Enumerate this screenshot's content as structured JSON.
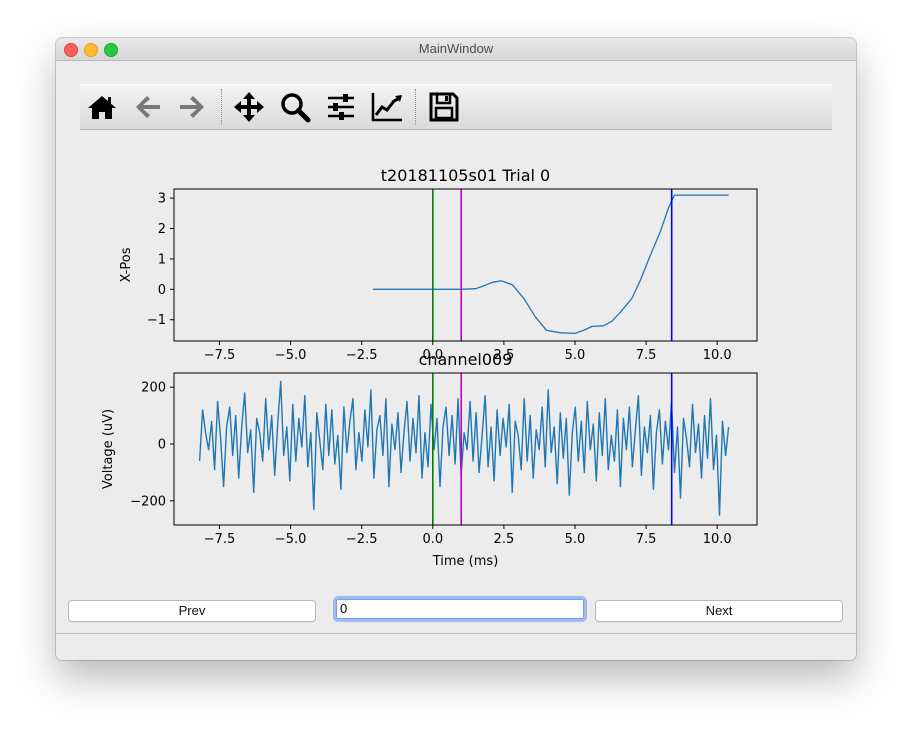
{
  "window": {
    "title": "MainWindow"
  },
  "toolbar": {
    "icons": [
      "home-icon",
      "back-icon",
      "forward-icon",
      "pan-icon",
      "zoom-icon",
      "subplots-icon",
      "customize-icon",
      "save-icon"
    ]
  },
  "controls": {
    "prev_label": "Prev",
    "next_label": "Next",
    "trial_value": "0"
  },
  "colors": {
    "trace": "#1f77b4",
    "green_marker": "#008000",
    "magenta_marker": "#bf00bf",
    "blue_marker": "#0000ff"
  },
  "chart_data": [
    {
      "type": "line",
      "title": "t20181105s01 Trial 0",
      "xlabel": "",
      "ylabel": "X-Pos",
      "xlim": [
        -9.1,
        11.4
      ],
      "ylim": [
        -1.7,
        3.3
      ],
      "xticks": [
        -7.5,
        -5.0,
        -2.5,
        0.0,
        2.5,
        5.0,
        7.5,
        10.0
      ],
      "xticklabels": [
        "−7.5",
        "−5.0",
        "−2.5",
        "0.0",
        "2.5",
        "5.0",
        "7.5",
        "10.0"
      ],
      "yticks": [
        -1,
        0,
        1,
        2,
        3
      ],
      "yticklabels": [
        "−1",
        "0",
        "1",
        "2",
        "3"
      ],
      "vlines": [
        {
          "x": 0.0,
          "color": "#008000"
        },
        {
          "x": 1.0,
          "color": "#bf00bf"
        },
        {
          "x": 8.4,
          "color": "#0000ff"
        }
      ],
      "series": [
        {
          "x": [
            -2.1,
            -1.0,
            0.0,
            1.0,
            1.5,
            1.8,
            2.1,
            2.4,
            2.8,
            3.2,
            3.6,
            4.0,
            4.5,
            5.0,
            5.3,
            5.6,
            6.0,
            6.3,
            6.6,
            7.0,
            7.3,
            7.6,
            8.0,
            8.3,
            8.5,
            9.0,
            9.5,
            10.0,
            10.4
          ],
          "y": [
            0.0,
            0.0,
            0.0,
            0.0,
            0.02,
            0.12,
            0.23,
            0.28,
            0.15,
            -0.3,
            -0.9,
            -1.35,
            -1.43,
            -1.45,
            -1.35,
            -1.22,
            -1.2,
            -1.05,
            -0.75,
            -0.3,
            0.3,
            1.0,
            1.9,
            2.7,
            3.1,
            3.1,
            3.1,
            3.1,
            3.1
          ]
        }
      ]
    },
    {
      "type": "line",
      "title": "channel009",
      "xlabel": "Time (ms)",
      "ylabel": "Voltage (uV)",
      "xlim": [
        -9.1,
        11.4
      ],
      "ylim": [
        -285,
        250
      ],
      "xticks": [
        -7.5,
        -5.0,
        -2.5,
        0.0,
        2.5,
        5.0,
        7.5,
        10.0
      ],
      "xticklabels": [
        "−7.5",
        "−5.0",
        "−2.5",
        "0.0",
        "2.5",
        "5.0",
        "7.5",
        "10.0"
      ],
      "yticks": [
        -200,
        0,
        200
      ],
      "yticklabels": [
        "−200",
        "0",
        "200"
      ],
      "vlines": [
        {
          "x": 0.0,
          "color": "#008000"
        },
        {
          "x": 1.0,
          "color": "#bf00bf"
        },
        {
          "x": 8.4,
          "color": "#0000ff"
        }
      ],
      "series": [
        {
          "x_start": -8.2,
          "x_end": 10.4,
          "y": [
            -60,
            120,
            40,
            -20,
            80,
            -90,
            150,
            20,
            -150,
            60,
            130,
            -40,
            100,
            -120,
            60,
            180,
            -30,
            50,
            -170,
            90,
            40,
            -60,
            160,
            -20,
            100,
            -110,
            70,
            220,
            -40,
            60,
            -130,
            140,
            -60,
            90,
            -10,
            170,
            -80,
            40,
            -230,
            110,
            10,
            -90,
            140,
            -40,
            120,
            -70,
            30,
            -160,
            130,
            -30,
            80,
            160,
            -90,
            40,
            -60,
            120,
            -10,
            190,
            -120,
            50,
            100,
            -40,
            160,
            -150,
            70,
            -20,
            110,
            -100,
            40,
            150,
            -60,
            90,
            -30,
            170,
            -120,
            40,
            -80,
            140,
            -20,
            90,
            -150,
            60,
            130,
            -40,
            100,
            -70,
            160,
            -110,
            40,
            -20,
            150,
            -60,
            110,
            -100,
            30,
            170,
            -80,
            60,
            -130,
            120,
            -40,
            90,
            -10,
            140,
            -170,
            80,
            30,
            -90,
            160,
            -60,
            100,
            -120,
            50,
            -20,
            130,
            -80,
            190,
            -30,
            60,
            -140,
            110,
            -50,
            90,
            -180,
            40,
            130,
            -60,
            80,
            -100,
            150,
            -20,
            70,
            -130,
            110,
            -40,
            160,
            -90,
            30,
            -60,
            120,
            -150,
            90,
            -20,
            130,
            -80,
            50,
            170,
            -110,
            60,
            -30,
            100,
            -160,
            40,
            120,
            -70,
            80,
            -20,
            150,
            -100,
            60,
            -190,
            90,
            20,
            -80,
            140,
            -30,
            70,
            -120,
            100,
            -50,
            160,
            -90,
            30,
            -250,
            80,
            -40,
            60
          ]
        }
      ]
    }
  ]
}
